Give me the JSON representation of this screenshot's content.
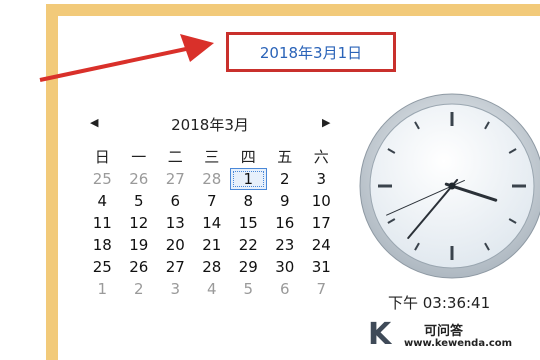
{
  "window": {
    "accent": "#f2ca7a"
  },
  "header": {
    "date_link": "2018年3月1日",
    "highlight_color": "#c9302c",
    "link_color": "#2a63b8"
  },
  "calendar": {
    "prev_icon": "◀",
    "next_icon": "▶",
    "month_title": "2018年3月",
    "weekdays": [
      "日",
      "一",
      "二",
      "三",
      "四",
      "五",
      "六"
    ],
    "weeks": [
      [
        "25",
        "26",
        "27",
        "28",
        "1",
        "2",
        "3"
      ],
      [
        "4",
        "5",
        "6",
        "7",
        "8",
        "9",
        "10"
      ],
      [
        "11",
        "12",
        "13",
        "14",
        "15",
        "16",
        "17"
      ],
      [
        "18",
        "19",
        "20",
        "21",
        "22",
        "23",
        "24"
      ],
      [
        "25",
        "26",
        "27",
        "28",
        "29",
        "30",
        "31"
      ],
      [
        "1",
        "2",
        "3",
        "4",
        "5",
        "6",
        "7"
      ]
    ],
    "today": "1"
  },
  "clock": {
    "time_text": "下午 03:36:41",
    "hours": 3,
    "minutes": 36,
    "seconds": 41
  },
  "watermark": {
    "logo_letter": "K",
    "title": "可问答",
    "url": "www.kewenda.com"
  }
}
